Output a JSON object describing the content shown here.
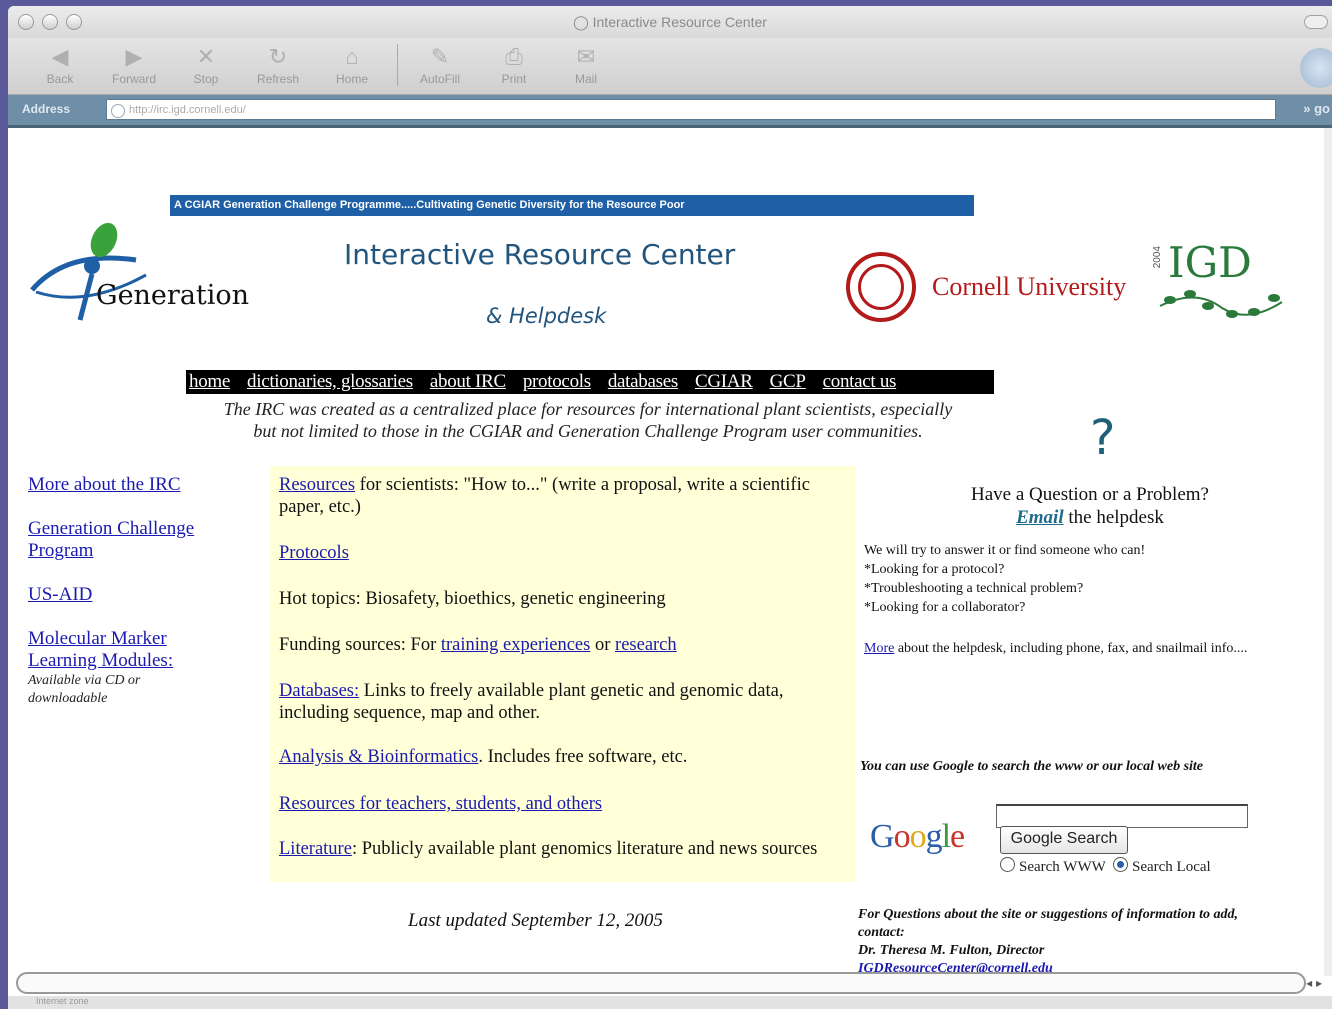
{
  "window": {
    "title": "Interactive Resource Center"
  },
  "toolbar": {
    "back": "Back",
    "forward": "Forward",
    "stop": "Stop",
    "refresh": "Refresh",
    "home": "Home",
    "autofill": "AutoFill",
    "print": "Print",
    "mail": "Mail"
  },
  "address": {
    "label": "Address",
    "url": "http://irc.igd.cornell.edu/",
    "go": "go"
  },
  "banner": "A CGIAR Generation Challenge Programme.....Cultivating Genetic Diversity for the Resource Poor",
  "logos": {
    "generation": "Generation",
    "cornell": "Cornell University",
    "igd": "IGD",
    "igd_vertical": "2004",
    "colors": {
      "cornell_red": "#b31b1b",
      "igd_green": "#2b7a3b",
      "irc_blue": "#22557e",
      "banner_blue": "#1f5fa6"
    }
  },
  "header": {
    "title": "Interactive Resource Center",
    "subtitle": "& Helpdesk"
  },
  "nav": [
    "home",
    "dictionaries, glossaries",
    "about IRC",
    "protocols",
    "databases",
    "CGIAR",
    "GCP",
    "contact us"
  ],
  "intro": {
    "line1": "The IRC was created as a centralized place for resources for international plant scientists, especially",
    "line2": "but not limited to those in the CGIAR and Generation Challenge Program user communities."
  },
  "left_links": {
    "irc": "More about the IRC",
    "gcp_1": "Generation Challenge",
    "gcp_2": "Program",
    "usaid": "US-AID",
    "mm_1": "Molecular Marker",
    "mm_2": "Learning Modules:",
    "mm_note_1": "Available via CD or",
    "mm_note_2": "downloadable"
  },
  "resources": {
    "r1_link": "Resources",
    "r1_text": " for scientists: \"How to...\" (write a proposal, write a scientific paper, etc.)",
    "r2_link": "Protocols",
    "r3_text": "Hot topics: Biosafety, bioethics, genetic engineering",
    "r4_text": "Funding sources: For ",
    "r4_link1": "training experiences",
    "r4_mid": " or ",
    "r4_link2": "research",
    "r5_link": "Databases:",
    "r5_text": " Links to freely available plant genetic and genomic data, including sequence, map and other.",
    "r6_link": "Analysis & Bioinformatics",
    "r6_text": ". Includes free software, etc.",
    "r7_link": "Resources for teachers, students, and others",
    "r8_link": "Literature",
    "r8_text": ": Publicly available plant genomics literature and news sources"
  },
  "updated": "Last updated September 12, 2005",
  "helpdesk": {
    "question_mark": "?",
    "line1": "Have a Question or a Problem?",
    "email_link": "Email",
    "line2_rest": " the helpdesk",
    "try": "We will try to answer it or find someone who can!",
    "b1": "*Looking for a protocol?",
    "b2": "*Troubleshooting a technical problem?",
    "b3": "*Looking for a collaborator?",
    "more_link": "More",
    "more_text": " about the helpdesk, including phone, fax, and snailmail info...."
  },
  "google": {
    "note": "You can use Google to search the www or our local web site",
    "logo": "Google",
    "query": "",
    "button": "Google Search",
    "opt_www": "Search WWW",
    "opt_local": "Search Local",
    "selected": "Search Local"
  },
  "contact": {
    "line1": "For Questions about the site or suggestions of information to add,",
    "line2": "contact:",
    "line3": "Dr. Theresa M. Fulton, Director",
    "email": "IGDResourceCenter@cornell.edu"
  },
  "status": {
    "text": "Internet zone"
  }
}
